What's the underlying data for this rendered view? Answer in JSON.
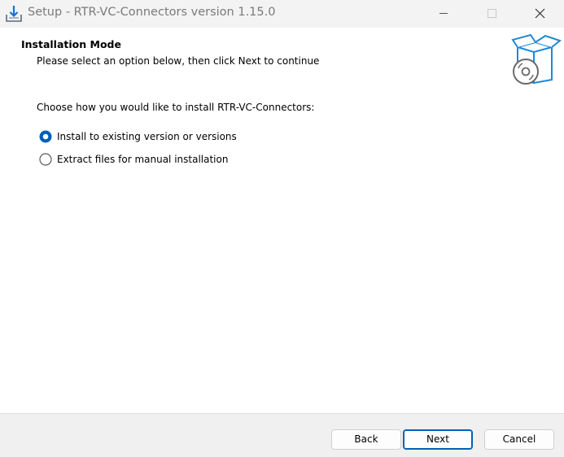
{
  "window": {
    "title": "Setup - RTR-VC-Connectors version 1.15.0"
  },
  "header": {
    "title": "Installation Mode",
    "subtitle": "Please select an option below, then click Next to continue"
  },
  "main": {
    "prompt": "Choose how you would like to install RTR-VC-Connectors:",
    "options": [
      {
        "label": "Install to existing version or versions",
        "selected": true
      },
      {
        "label": "Extract files for manual installation",
        "selected": false
      }
    ]
  },
  "footer": {
    "back_label": "Back",
    "next_label": "Next",
    "cancel_label": "Cancel"
  },
  "icons": {
    "app": "setup-download-icon",
    "header": "box-disc-icon",
    "minimize": "minimize-icon",
    "maximize": "maximize-icon",
    "close": "close-icon"
  },
  "colors": {
    "accent": "#005fb8",
    "titlebar": "#f3f3f3",
    "footer": "#f0f0f0"
  }
}
